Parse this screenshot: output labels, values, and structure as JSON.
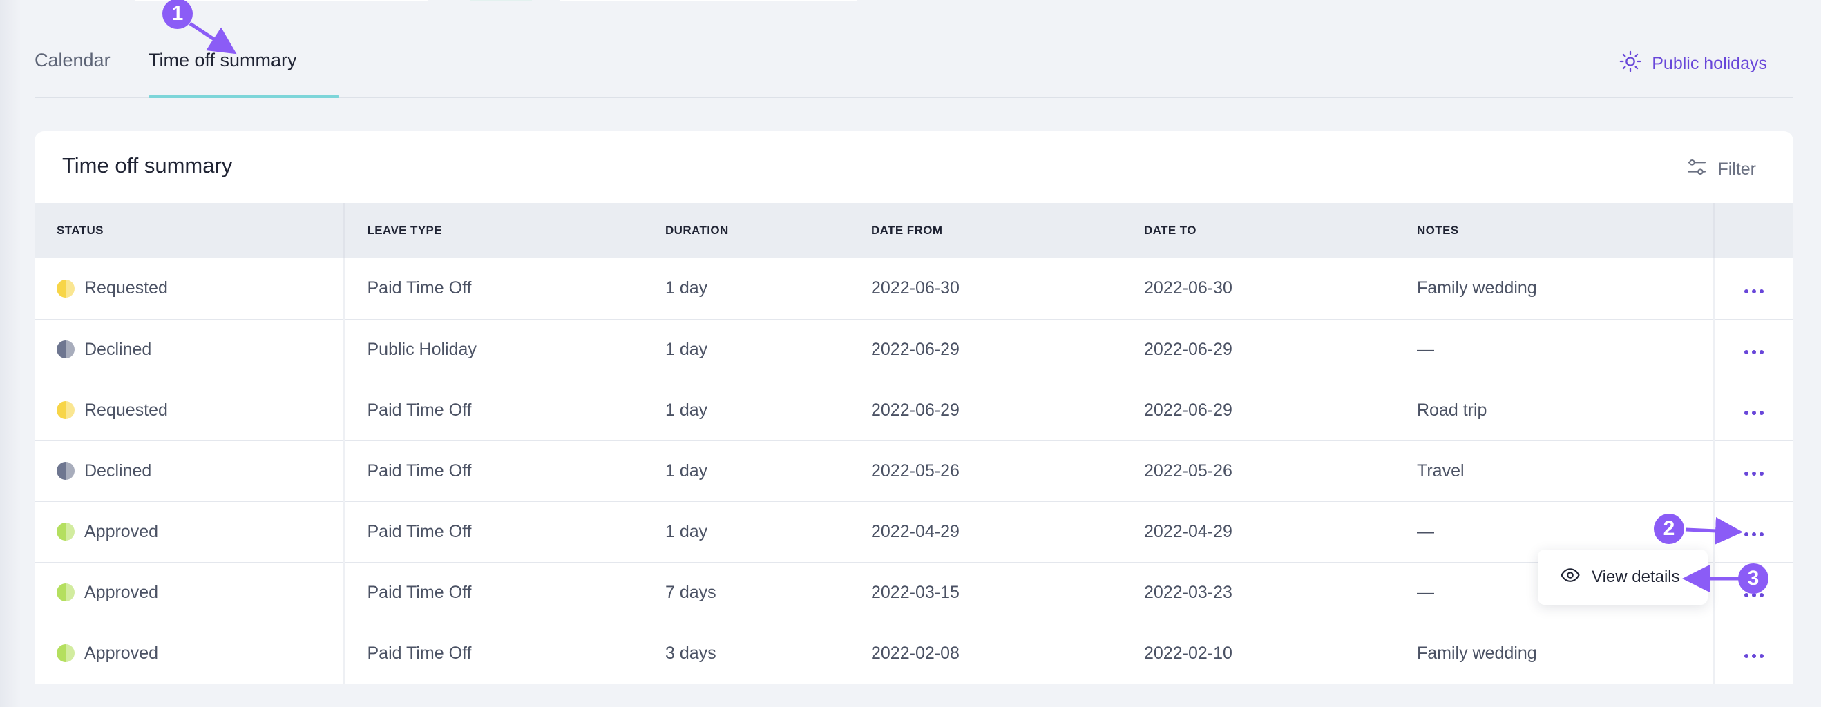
{
  "tabs": [
    {
      "label": "Calendar"
    },
    {
      "label": "Time off summary"
    }
  ],
  "public_holidays_label": "Public holidays",
  "card": {
    "title": "Time off summary",
    "filter_label": "Filter"
  },
  "table": {
    "headers": [
      "STATUS",
      "LEAVE TYPE",
      "DURATION",
      "DATE FROM",
      "DATE TO",
      "NOTES"
    ],
    "rows": [
      {
        "status": "Requested",
        "leave_type": "Paid Time Off",
        "duration": "1 day",
        "date_from": "2022-06-30",
        "date_to": "2022-06-30",
        "notes": "Family wedding"
      },
      {
        "status": "Declined",
        "leave_type": "Public Holiday",
        "duration": "1 day",
        "date_from": "2022-06-29",
        "date_to": "2022-06-29",
        "notes": "—"
      },
      {
        "status": "Requested",
        "leave_type": "Paid Time Off",
        "duration": "1 day",
        "date_from": "2022-06-29",
        "date_to": "2022-06-29",
        "notes": "Road trip"
      },
      {
        "status": "Declined",
        "leave_type": "Paid Time Off",
        "duration": "1 day",
        "date_from": "2022-05-26",
        "date_to": "2022-05-26",
        "notes": "Travel"
      },
      {
        "status": "Approved",
        "leave_type": "Paid Time Off",
        "duration": "1 day",
        "date_from": "2022-04-29",
        "date_to": "2022-04-29",
        "notes": "—"
      },
      {
        "status": "Approved",
        "leave_type": "Paid Time Off",
        "duration": "7 days",
        "date_from": "2022-03-15",
        "date_to": "2022-03-23",
        "notes": "—"
      },
      {
        "status": "Approved",
        "leave_type": "Paid Time Off",
        "duration": "3 days",
        "date_from": "2022-02-08",
        "date_to": "2022-02-10",
        "notes": "Family wedding"
      }
    ]
  },
  "status_colors": {
    "Requested": "#f7d548",
    "Declined": "#6e7690",
    "Approved": "#b4df5f"
  },
  "dropdown": {
    "view_details_label": "View details"
  },
  "annotations": [
    "1",
    "2",
    "3"
  ],
  "colors": {
    "accent": "#6846d9",
    "tab_underline": "#7dd5d9",
    "annotation": "#8b5cf6"
  }
}
